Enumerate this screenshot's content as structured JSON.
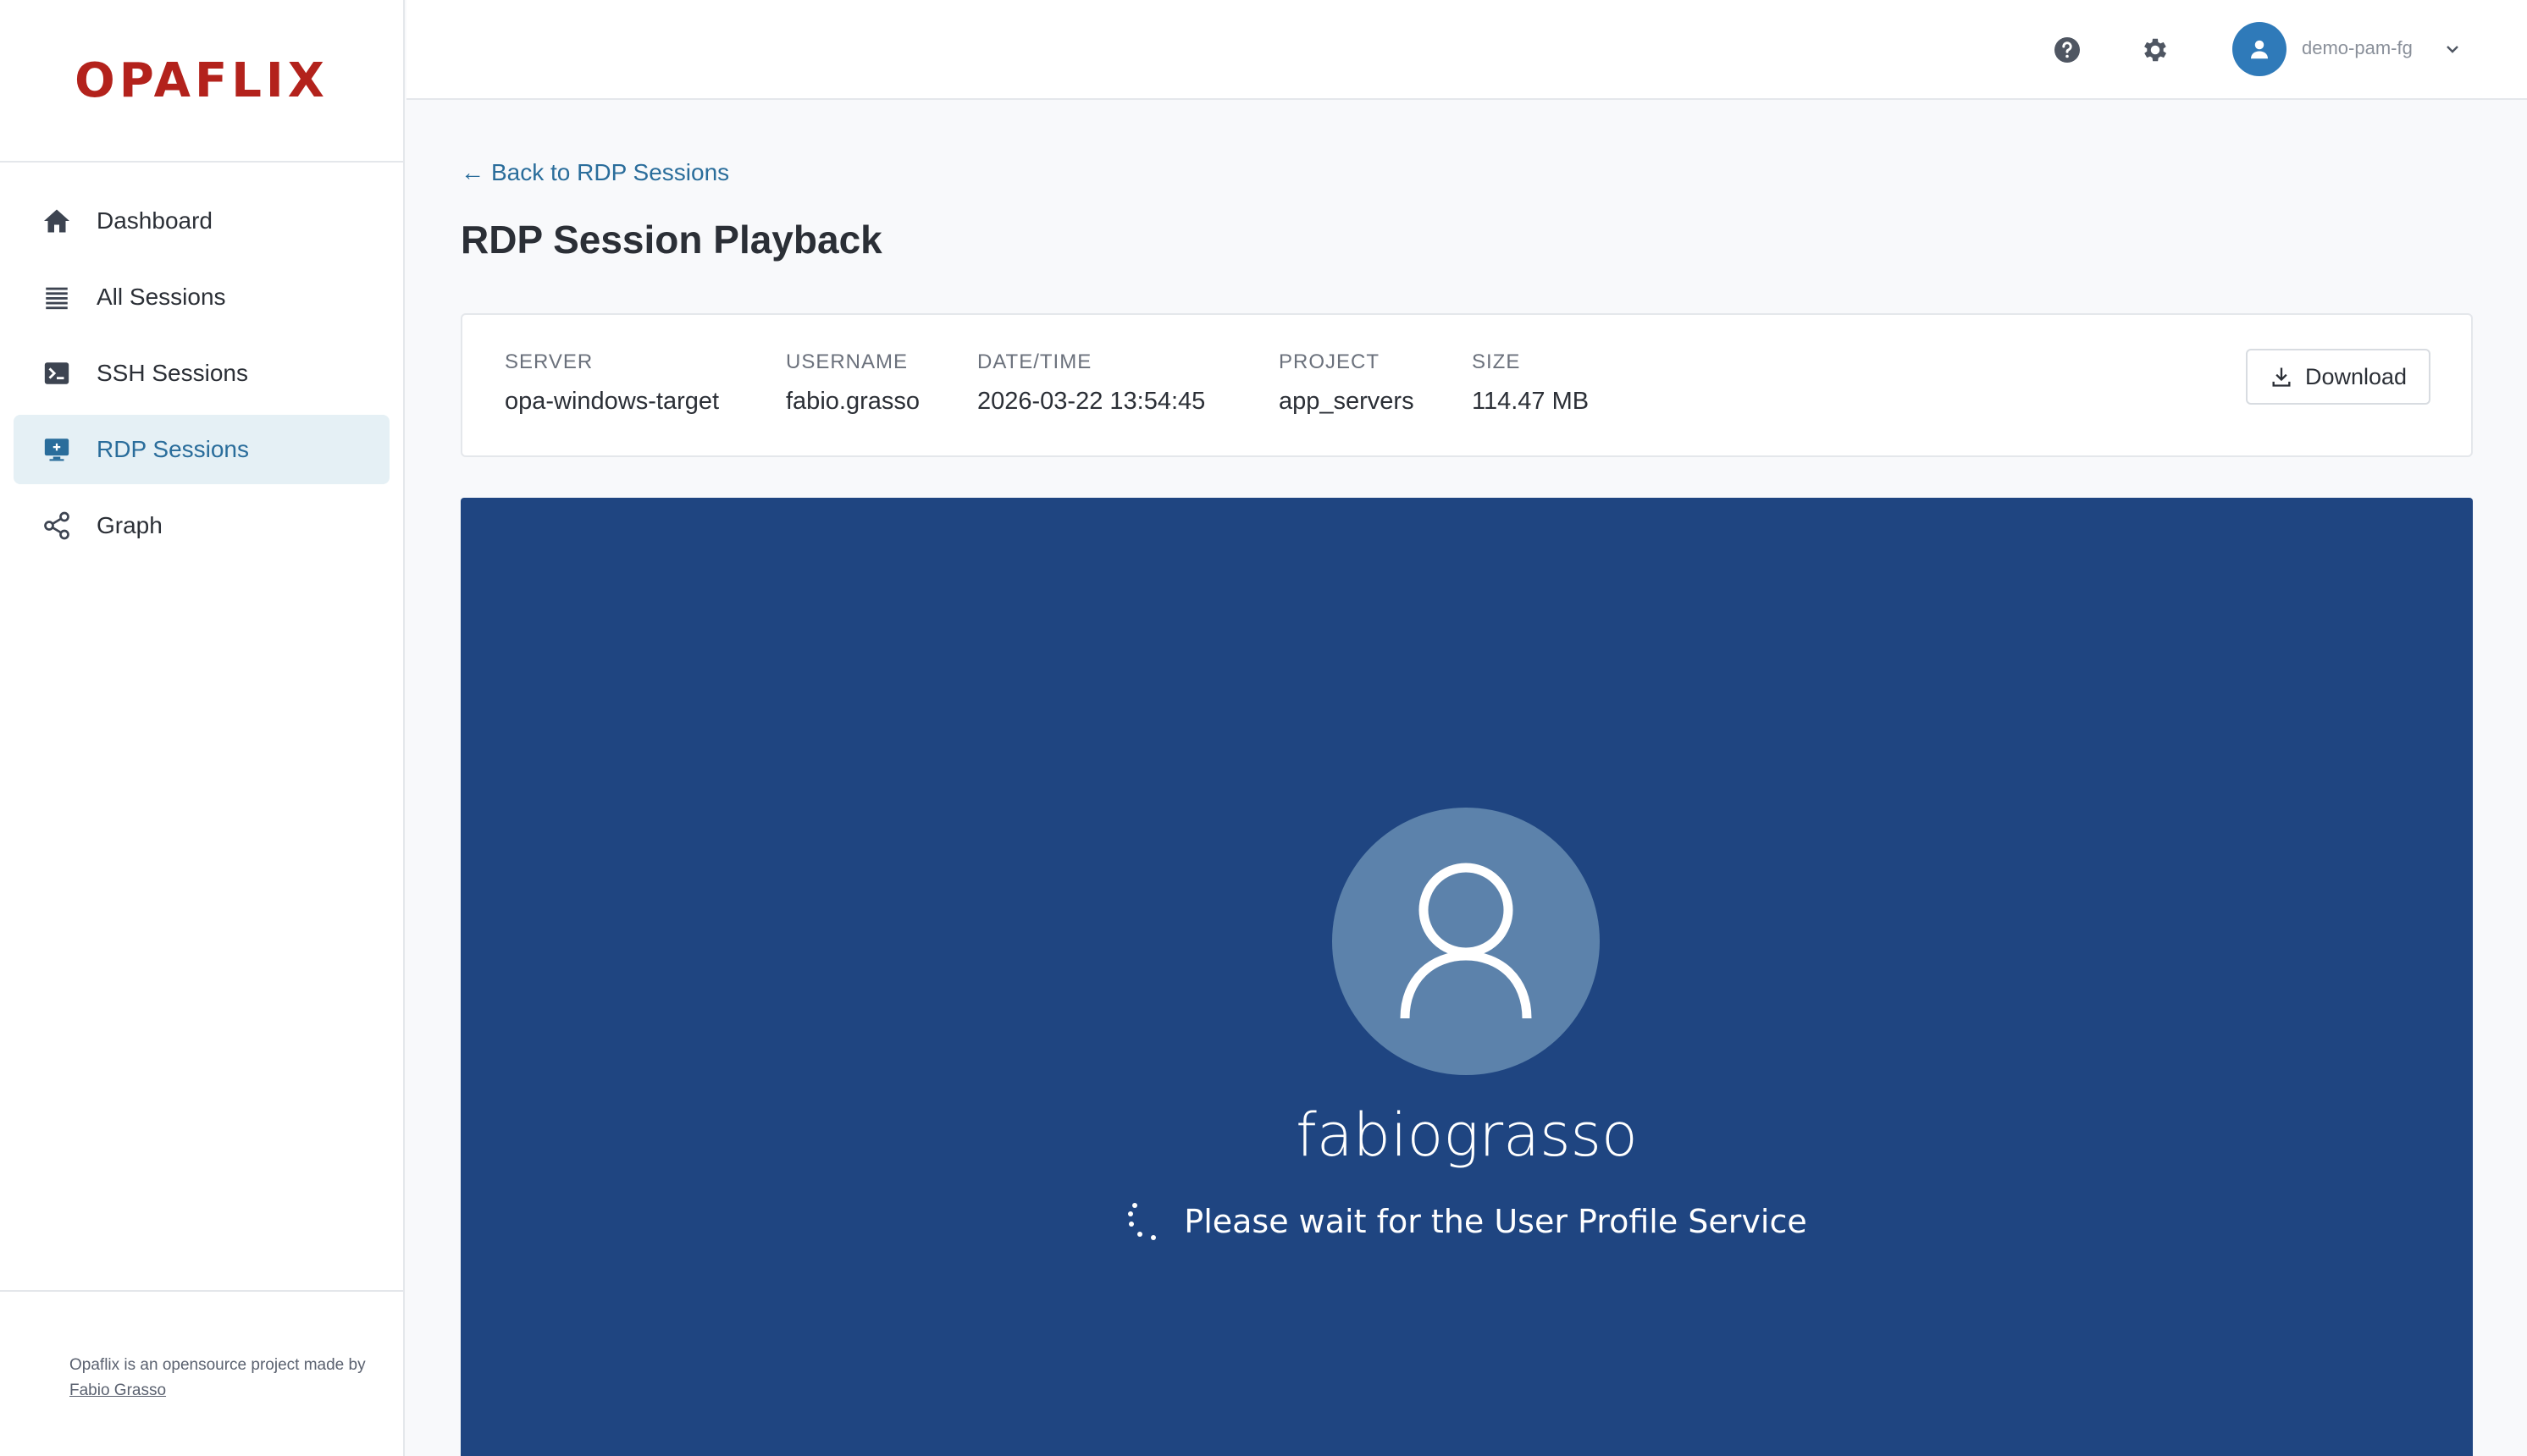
{
  "app": {
    "logo": "OPAFLIX",
    "footer_text": "Opaflix is an opensource project made by",
    "footer_link": "Fabio Grasso"
  },
  "sidebar": {
    "items": [
      {
        "label": "Dashboard",
        "icon": "home-icon",
        "active": false
      },
      {
        "label": "All Sessions",
        "icon": "list-icon",
        "active": false
      },
      {
        "label": "SSH Sessions",
        "icon": "terminal-icon",
        "active": false
      },
      {
        "label": "RDP Sessions",
        "icon": "monitor-icon",
        "active": true
      },
      {
        "label": "Graph",
        "icon": "share-graph-icon",
        "active": false
      }
    ]
  },
  "topbar": {
    "help_icon": "help-circle-icon",
    "settings_icon": "gear-icon",
    "user_name": "demo-pam-fg"
  },
  "main": {
    "back_link": "Back to RDP Sessions",
    "title": "RDP Session Playback",
    "info": {
      "server_label": "SERVER",
      "server": "opa-windows-target",
      "username_label": "USERNAME",
      "username": "fabio.grasso",
      "datetime_label": "DATE/TIME",
      "datetime": "2026-03-22 13:54:45",
      "project_label": "PROJECT",
      "project": "app_servers",
      "size_label": "SIZE",
      "size": "114.47 MB"
    },
    "download_label": "Download"
  },
  "player": {
    "user_display": "fabiograsso",
    "status_message": "Please wait for the User Profile Service"
  },
  "colors": {
    "brand": "#b3221c",
    "accent": "#2a6d9b",
    "player_bg": "#1f4581",
    "avatar_bg": "#2f7ab9"
  }
}
